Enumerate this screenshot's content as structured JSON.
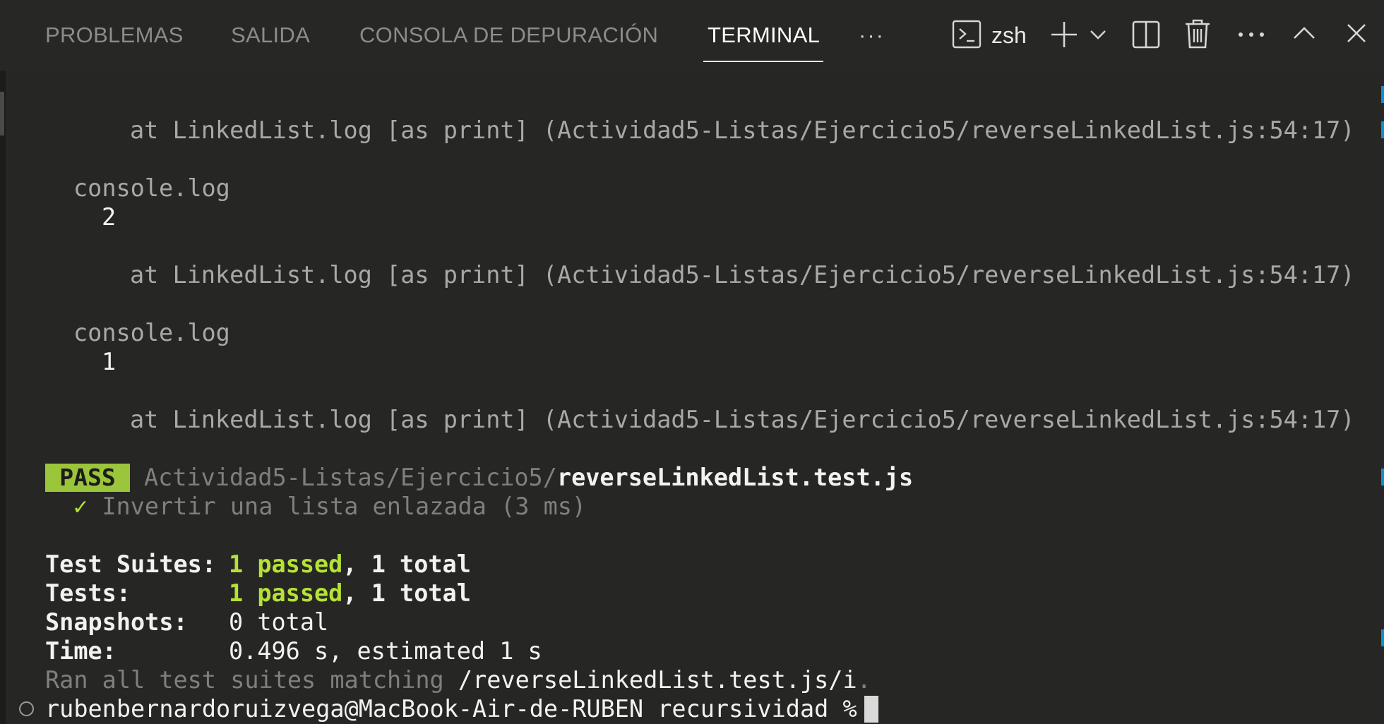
{
  "tabs": [
    {
      "label": "PROBLEMAS"
    },
    {
      "label": "SALIDA"
    },
    {
      "label": "CONSOLA DE DEPURACIÓN"
    },
    {
      "label": "TERMINAL",
      "active": true
    }
  ],
  "toolbar": {
    "more_tabs": "···",
    "shell_name": "zsh",
    "icons": [
      "terminal-icon",
      "plus-icon",
      "chevron-down-icon",
      "split-icon",
      "trash-icon",
      "ellipsis-icon",
      "chevron-up-icon",
      "close-icon"
    ]
  },
  "terminal": {
    "at_line": "at LinkedList.log [as print] (Actividad5-Listas/Ejercicio5/reverseLinkedList.js:54:17)",
    "console_log": "console.log",
    "value_2": "2",
    "value_1": "1",
    "pass_badge": "PASS",
    "test_path_prefix": "Actividad5-Listas/Ejercicio5/",
    "test_file": "reverseLinkedList.test.js",
    "check_mark": "✓",
    "test_name": "Invertir una lista enlazada (3 ms)",
    "suites_label": "Test Suites:",
    "suites_passed": "1 passed",
    "suites_total": ", 1 total",
    "tests_label": "Tests:",
    "tests_passed": "1 passed",
    "tests_total": ", 1 total",
    "snapshots_label": "Snapshots:",
    "snapshots_value": "0 total",
    "time_label": "Time:",
    "time_value": "0.496 s, estimated 1 s",
    "ran_prefix": "Ran all test suites matching ",
    "ran_pattern": "/reverseLinkedList.test.js/i",
    "ran_suffix": ".",
    "prompt": "rubenbernardoruizvega@MacBook-Air-de-RUBEN recursividad % "
  },
  "colors": {
    "background": "#262624",
    "pass_badge": "#9bc53b",
    "passed_green": "#b5e236",
    "text_dim": "#a9a9a4",
    "text_white": "#f2f2f2",
    "scroll_accent": "#1a8ad0"
  }
}
